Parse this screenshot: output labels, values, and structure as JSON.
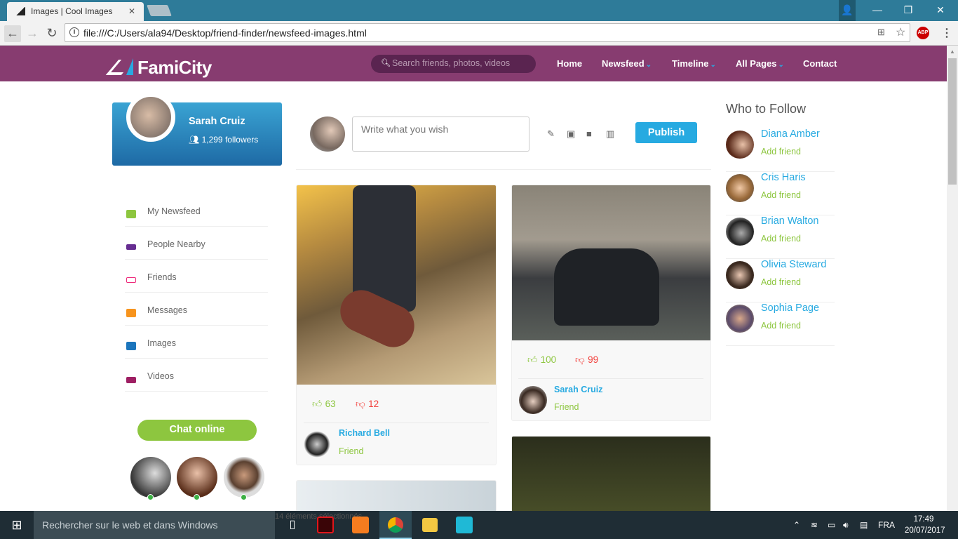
{
  "browser": {
    "tab_title": "Images | Cool Images",
    "url": "file:///C:/Users/ala94/Desktop/friend-finder/newsfeed-images.html"
  },
  "navbar": {
    "brand": "FamiCity",
    "search_placeholder": "Search friends, photos, videos",
    "menu": [
      {
        "label": "Home",
        "dropdown": false
      },
      {
        "label": "Newsfeed",
        "dropdown": true
      },
      {
        "label": "Timeline",
        "dropdown": true
      },
      {
        "label": "All Pages",
        "dropdown": true
      },
      {
        "label": "Contact",
        "dropdown": false
      }
    ]
  },
  "profile": {
    "name": "Sarah Cruiz",
    "followers": "1,299 followers"
  },
  "sidebar": {
    "items": [
      {
        "label": "My Newsfeed",
        "icon": "newspaper-icon",
        "color": "#8dc63f"
      },
      {
        "label": "People Nearby",
        "icon": "users-icon",
        "color": "#662d91"
      },
      {
        "label": "Friends",
        "icon": "friends-icon",
        "color": "#ee2a7b"
      },
      {
        "label": "Messages",
        "icon": "chat-bubbles-icon",
        "color": "#f7941d"
      },
      {
        "label": "Images",
        "icon": "image-icon",
        "color": "#1c75bc"
      },
      {
        "label": "Videos",
        "icon": "video-camera-icon",
        "color": "#9e1f63"
      }
    ],
    "chat_label": "Chat online"
  },
  "composer": {
    "placeholder": "Write what you wish",
    "publish_label": "Publish"
  },
  "posts": [
    {
      "likes": "63",
      "dislikes": "12",
      "author": "Richard Bell",
      "relation": "Friend"
    },
    {
      "likes": "100",
      "dislikes": "99",
      "author": "Sarah Cruiz",
      "relation": "Friend"
    }
  ],
  "who_to_follow": {
    "title": "Who to Follow",
    "people": [
      {
        "name": "Diana Amber",
        "action": "Add friend"
      },
      {
        "name": "Cris Haris",
        "action": "Add friend"
      },
      {
        "name": "Brian Walton",
        "action": "Add friend"
      },
      {
        "name": "Olivia Steward",
        "action": "Add friend"
      },
      {
        "name": "Sophia Page",
        "action": "Add friend"
      }
    ]
  },
  "taskbar": {
    "search_placeholder": "Rechercher sur le web et dans Windows",
    "behind_text": "14 éléments sélectionnés",
    "language": "FRA",
    "time": "17:49",
    "date": "20/07/2017"
  }
}
